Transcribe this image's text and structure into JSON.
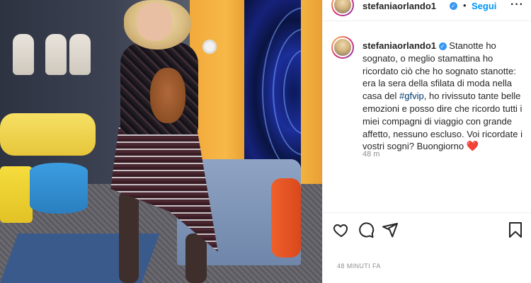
{
  "post": {
    "username": "stefaniaorlando1",
    "follow_separator": "•",
    "follow_label": "Segui",
    "more_label": "···",
    "verified_icon": "✓",
    "caption_line_1": "Stanotte ho sognato, o meglio stamattina ho ricordato ciò che ho sognato stanotte: era la sera della sfilata di moda nella casa del ",
    "hashtag": "#gfvip",
    "caption_line_2": ", ho rivissuto tante belle emozioni e posso dire che ricordo tutti i miei compagni di viaggio con grande affetto, nessuno escluso. Voi ricordate i vostri sogni? Buongiorno ",
    "heart_emoji": "❤️",
    "comment_time": "48 m",
    "posted_ago": "48 MINUTI FA"
  },
  "icons": {
    "like": "heart-icon",
    "comment": "comment-icon",
    "share": "share-icon",
    "save": "bookmark-icon"
  },
  "colors": {
    "link": "#0095f6",
    "hashtag": "#00376b",
    "heart": "#ed4956",
    "muted": "#8e8e8e",
    "verified": "#3897f0"
  }
}
